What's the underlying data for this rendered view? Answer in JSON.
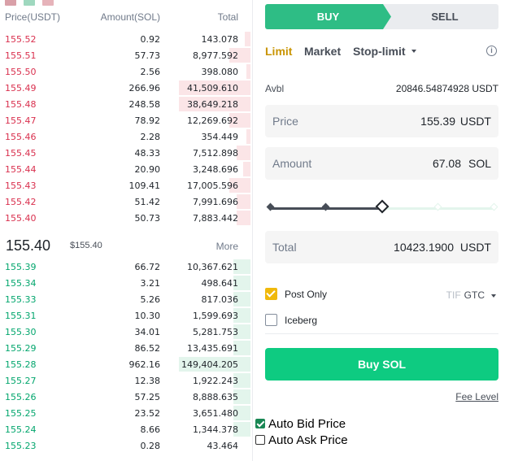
{
  "orderbook": {
    "header": {
      "price": "Price(USDT)",
      "amount": "Amount(SOL)",
      "total": "Total"
    },
    "asks": [
      {
        "price": "155.52",
        "amount": "0.92",
        "total": "143.078",
        "depth": 0.08
      },
      {
        "price": "155.51",
        "amount": "57.73",
        "total": "8,977.592",
        "depth": 0.29
      },
      {
        "price": "155.50",
        "amount": "2.56",
        "total": "398.080",
        "depth": 0.06
      },
      {
        "price": "155.49",
        "amount": "266.96",
        "total": "41,509.610",
        "depth": 1.0
      },
      {
        "price": "155.48",
        "amount": "248.58",
        "total": "38,649.218",
        "depth": 1.0
      },
      {
        "price": "155.47",
        "amount": "78.92",
        "total": "12,269.692",
        "depth": 0.29
      },
      {
        "price": "155.46",
        "amount": "2.28",
        "total": "354.449",
        "depth": 0.06
      },
      {
        "price": "155.45",
        "amount": "48.33",
        "total": "7,512.898",
        "depth": 0.19
      },
      {
        "price": "155.44",
        "amount": "20.90",
        "total": "3,248.696",
        "depth": 0.1
      },
      {
        "price": "155.43",
        "amount": "109.41",
        "total": "17,005.596",
        "depth": 0.29
      },
      {
        "price": "155.42",
        "amount": "51.42",
        "total": "7,991.696",
        "depth": 0.19
      },
      {
        "price": "155.40",
        "amount": "50.73",
        "total": "7,883.442",
        "depth": 0.19
      }
    ],
    "mid": {
      "price": "155.40",
      "fiat": "$155.40",
      "more": "More"
    },
    "bids": [
      {
        "price": "155.39",
        "amount": "66.72",
        "total": "10,367.621",
        "depth": 0.24
      },
      {
        "price": "155.34",
        "amount": "3.21",
        "total": "498.641",
        "depth": 0.24
      },
      {
        "price": "155.33",
        "amount": "5.26",
        "total": "817.036",
        "depth": 0.24
      },
      {
        "price": "155.31",
        "amount": "10.30",
        "total": "1,599.693",
        "depth": 0.24
      },
      {
        "price": "155.30",
        "amount": "34.01",
        "total": "5,281.753",
        "depth": 0.24
      },
      {
        "price": "155.29",
        "amount": "86.52",
        "total": "13,435.691",
        "depth": 0.24
      },
      {
        "price": "155.28",
        "amount": "962.16",
        "total": "149,404.205",
        "depth": 1.0
      },
      {
        "price": "155.27",
        "amount": "12.38",
        "total": "1,922.243",
        "depth": 0.24
      },
      {
        "price": "155.26",
        "amount": "57.25",
        "total": "8,888.635",
        "depth": 0.24
      },
      {
        "price": "155.25",
        "amount": "23.52",
        "total": "3,651.480",
        "depth": 0.24
      },
      {
        "price": "155.24",
        "amount": "8.66",
        "total": "1,344.378",
        "depth": 0.24
      },
      {
        "price": "155.23",
        "amount": "0.28",
        "total": "43.464",
        "depth": 0.0
      }
    ]
  },
  "form": {
    "tabs": {
      "buy": "BUY",
      "sell": "SELL"
    },
    "types": {
      "limit": "Limit",
      "market": "Market",
      "stop": "Stop-limit",
      "info": "i"
    },
    "avbl": {
      "label": "Avbl",
      "value": "20846.54874928 USDT"
    },
    "price": {
      "label": "Price",
      "value": "155.39",
      "unit": "USDT"
    },
    "amount": {
      "label": "Amount",
      "value": "67.08",
      "unit": "SOL"
    },
    "slider": {
      "level": 0.5
    },
    "total": {
      "label": "Total",
      "value": "10423.1900",
      "unit": "USDT"
    },
    "post_only": {
      "label": "Post Only",
      "checked": true
    },
    "tif": {
      "label": "TIF",
      "value": "GTC"
    },
    "iceberg": {
      "label": "Iceberg",
      "checked": false
    },
    "buy_button": "Buy SOL",
    "fee_level": "Fee Level"
  },
  "auto": {
    "bid": {
      "label": "Auto Bid Price",
      "checked": true
    },
    "ask": {
      "label": "Auto Ask Price",
      "checked": false
    }
  },
  "colors": {
    "ask": "#d9304e",
    "bid": "#03a66d",
    "buy": "#0ecb81",
    "accent": "#c99400"
  }
}
